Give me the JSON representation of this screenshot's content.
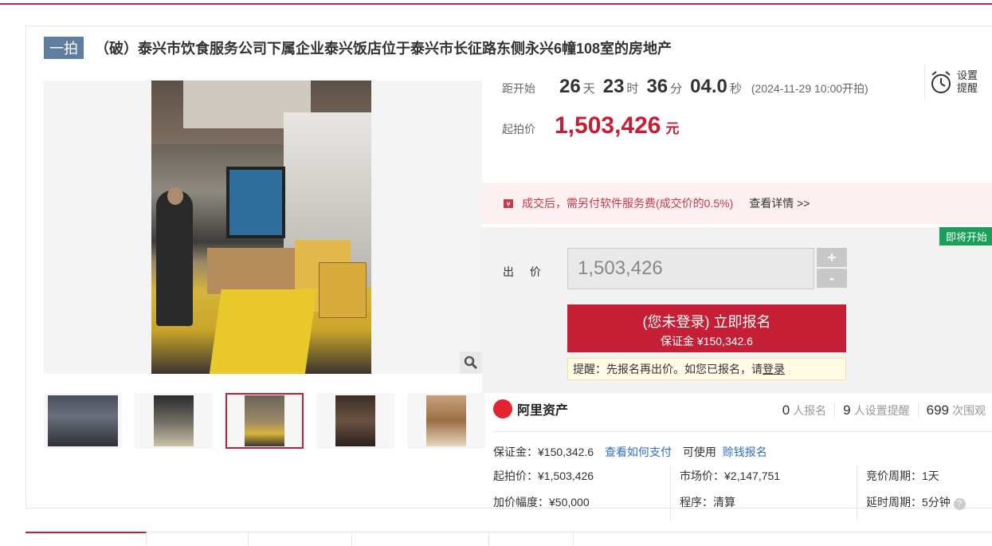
{
  "header": {
    "badge": "一拍",
    "title": "（破）泰兴市饮食服务公司下属企业泰兴饭店位于泰兴市长征路东侧永兴6幢108室的房地产"
  },
  "countdown": {
    "label": "距开始",
    "days": "26",
    "days_unit": "天",
    "hours": "23",
    "hours_unit": "时",
    "minutes": "36",
    "minutes_unit": "分",
    "seconds": "04.0",
    "seconds_unit": "秒",
    "start_note": "(2024-11-29 10:00开拍)"
  },
  "remind": {
    "line1": "设置",
    "line2": "提醒",
    "icon": "alarm-clock-icon"
  },
  "start_price": {
    "label": "起拍价",
    "value": "1,503,426",
    "unit": "元"
  },
  "notice": {
    "text": "成交后，需另付软件服务费(成交价的0.5%)",
    "link": "查看详情 >>"
  },
  "bid": {
    "status_badge": "即将开始",
    "label": "出 价",
    "input_value": "1,503,426",
    "plus": "+",
    "minus": "-",
    "signup_line1": "(您未登录) 立即报名",
    "signup_line2": "保证金 ¥150,342.6",
    "tip_prefix": "提醒：先报名再出价。如您已报名，请",
    "tip_link": "登录"
  },
  "brand": {
    "name": "阿里资产"
  },
  "stats": [
    {
      "num": "0",
      "label": "人报名"
    },
    {
      "num": "9",
      "label": "人设置提醒"
    },
    {
      "num": "699",
      "label": "次围观"
    }
  ],
  "deposit": {
    "label": "保证金：¥150,342.6",
    "how_to_pay": "查看如何支付",
    "usable": "可使用",
    "credit_signup": "赊钱报名"
  },
  "details": {
    "start_price": "起拍价：¥1,503,426",
    "increment": "加价幅度：¥50,000",
    "market_price": "市场价：¥2,147,751",
    "procedure": "程序：清算",
    "cycle": "竞价周期：1天",
    "delay": "延时周期：5分钟",
    "help": "?"
  },
  "colors": {
    "accent": "#c41f35",
    "brand": "#b8256a",
    "badge_green": "#18a058",
    "link_blue": "#2f6fb8"
  }
}
